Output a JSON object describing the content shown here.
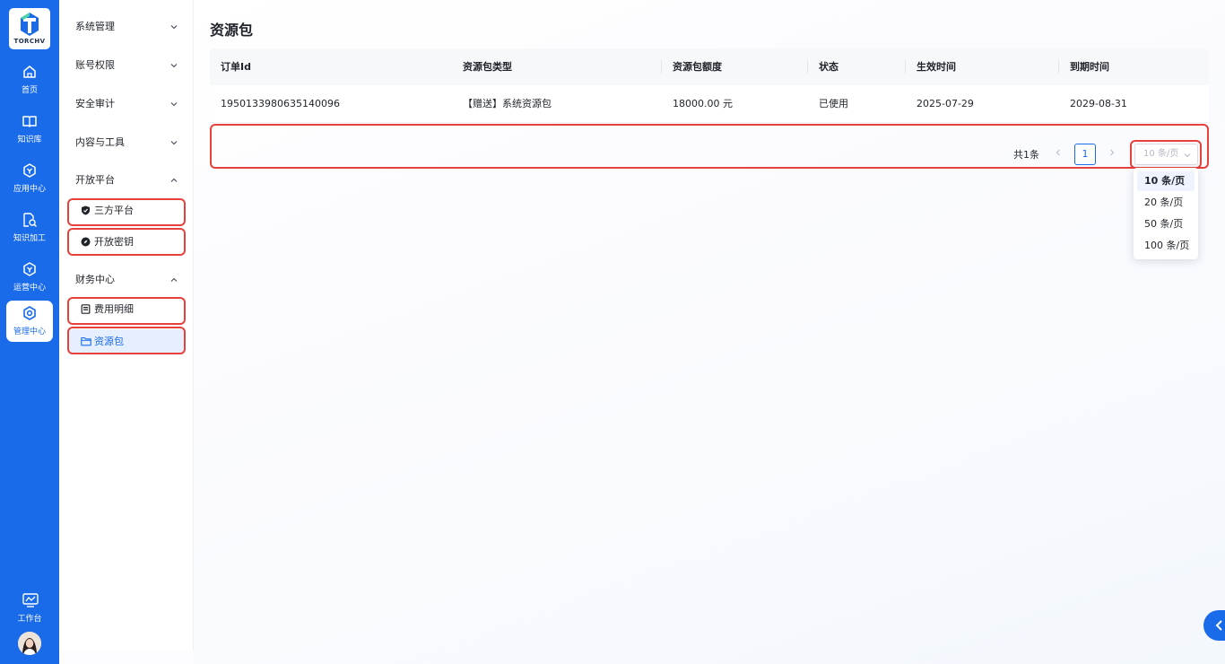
{
  "brand": {
    "logo_text": "TORCHV"
  },
  "rail": {
    "items": [
      {
        "label": "首页"
      },
      {
        "label": "知识库"
      },
      {
        "label": "应用中心"
      },
      {
        "label": "知识加工"
      },
      {
        "label": "运营中心"
      },
      {
        "label": "管理中心"
      }
    ],
    "workbench": "工作台"
  },
  "subnav": {
    "groups": [
      {
        "label": "系统管理"
      },
      {
        "label": "账号权限"
      },
      {
        "label": "安全审计"
      },
      {
        "label": "内容与工具"
      },
      {
        "label": "开放平台"
      },
      {
        "label": "财务中心"
      }
    ],
    "items": [
      {
        "label": "三方平台"
      },
      {
        "label": "开放密钥"
      },
      {
        "label": "费用明细"
      },
      {
        "label": "资源包"
      }
    ]
  },
  "page": {
    "title": "资源包"
  },
  "table": {
    "columns": [
      "订单Id",
      "资源包类型",
      "资源包额度",
      "状态",
      "生效时间",
      "到期时间"
    ],
    "rows": [
      [
        "1950133980635140096",
        "【赠送】系统资源包",
        "18000.00 元",
        "已使用",
        "2025-07-29",
        "2029-08-31"
      ]
    ]
  },
  "pagination": {
    "total": "共1条",
    "current": "1",
    "page_size": "10 条/页",
    "options": [
      "10 条/页",
      "20 条/页",
      "50 条/页",
      "100 条/页"
    ]
  },
  "colors": {
    "primary": "#1a6bea",
    "highlight": "#e6413a",
    "active_bg": "#e6efff"
  }
}
